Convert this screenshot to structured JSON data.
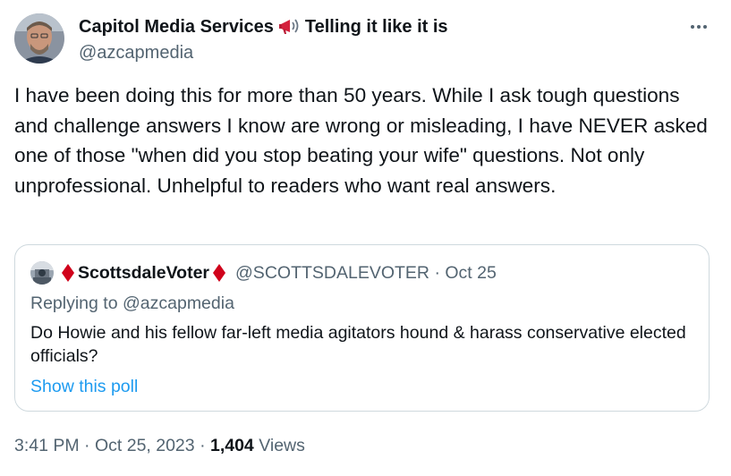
{
  "author": {
    "display_name": "Capitol Media Services",
    "tagline": "Telling it like it is",
    "handle": "@azcapmedia",
    "emoji_icon": "megaphone-icon"
  },
  "tweet": {
    "text": "I have been doing this for more than 50 years. While I ask tough questions and challenge answers I know are wrong or misleading, I have NEVER asked one of those \"when did you stop beating your wife\" questions. Not only unprofessional. Unhelpful to readers who want real answers."
  },
  "quoted": {
    "display_name": "ScottsdaleVoter",
    "handle": "@SCOTTSDALEVOTER",
    "separator": "·",
    "date": "Oct 25",
    "reply_prefix": "Replying to",
    "reply_handle": "@azcapmedia",
    "text": "Do Howie and his fellow far-left media agitators hound & harass conservative elected officials?",
    "poll_link": "Show this poll",
    "name_icon": "red-diamond-icon"
  },
  "meta": {
    "time": "3:41 PM",
    "date": "Oct 25, 2023",
    "separator": "·",
    "views_count": "1,404",
    "views_label": "Views"
  },
  "colors": {
    "text_primary": "#0f1419",
    "text_secondary": "#536471",
    "link": "#1d9bf0",
    "border": "#cfd9de",
    "diamond": "#d0021b"
  }
}
